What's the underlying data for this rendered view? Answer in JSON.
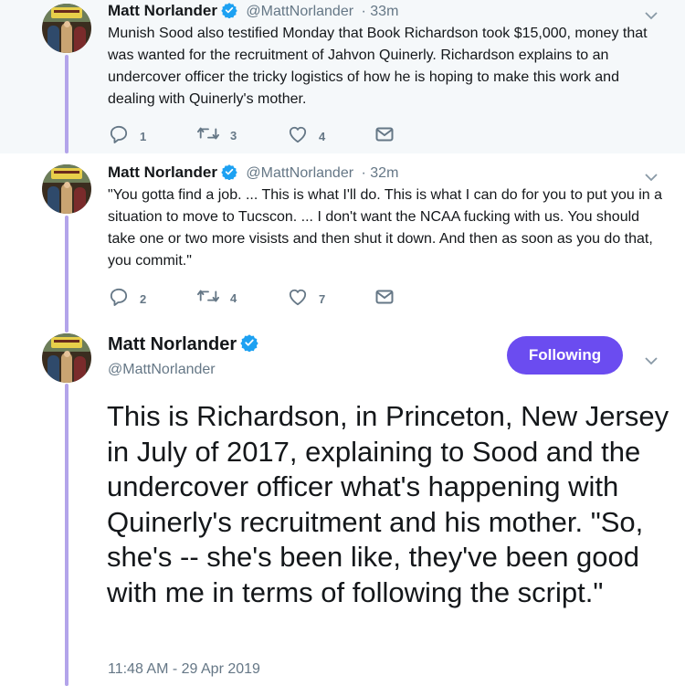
{
  "tweets": [
    {
      "name": "Matt Norlander",
      "handle": "@MattNorlander",
      "time": "· 33m",
      "text": "Munish Sood also testified Monday that Book Richardson took $15,000, money that was wanted for the recruitment of Jahvon Quinerly. Richardson explains to an undercover officer the tricky logistics of how he is hoping to make this work and dealing with Quinerly's mother.",
      "replies": "1",
      "retweets": "3",
      "likes": "4"
    },
    {
      "name": "Matt Norlander",
      "handle": "@MattNorlander",
      "time": "· 32m",
      "text": "\"You gotta find a job. ... This is what I'll do. This is what I can do for you to put you in a situation to move to Tucscon. ... I don't want the NCAA fucking with us. You should take one or two more visists and then shut it down. And then as soon as you do that, you commit.\"",
      "replies": "2",
      "retweets": "4",
      "likes": "7"
    }
  ],
  "main_tweet": {
    "name": "Matt Norlander",
    "handle": "@MattNorlander",
    "follow_label": "Following",
    "text": "This is Richardson, in Princeton, New Jersey in July of 2017, explaining to Sood and the undercover officer what's happening with Quinerly's recruitment and his mother. \"So, she's -- she's been like, they've been good with me in terms of following the script.\"",
    "timestamp": "11:48 AM - 29 Apr 2019"
  },
  "colors": {
    "accent": "#6b4cf0",
    "thread_line": "#b3a4ea",
    "verified": "#1da1f2",
    "secondary_text": "#657786",
    "highlight_bg": "#f5f8fa"
  },
  "icons": [
    "reply-icon",
    "retweet-icon",
    "like-icon",
    "message-icon",
    "verified-icon",
    "chevron-down-icon"
  ]
}
